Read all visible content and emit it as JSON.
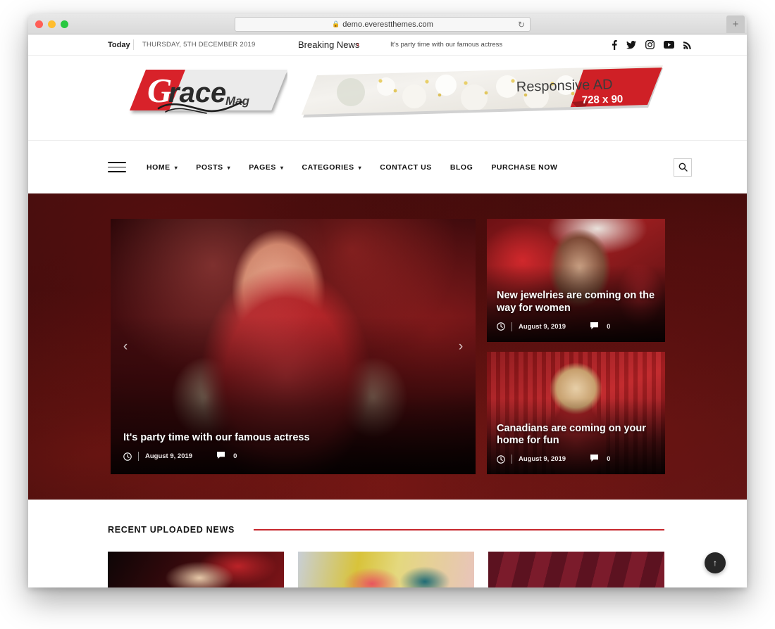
{
  "browser": {
    "url": "demo.everestthemes.com",
    "lock_icon": "lock-icon",
    "reload_icon": "reload-icon",
    "new_tab_icon": "plus-icon"
  },
  "topbar": {
    "today_label": "Today",
    "date": "THURSDAY, 5TH DECEMBER 2019",
    "breaking_label": "Breaking News",
    "breaking_arrow": "›",
    "breaking_text": "It's party time with our famous actress",
    "social": [
      {
        "name": "facebook-icon",
        "label": "Facebook"
      },
      {
        "name": "twitter-icon",
        "label": "Twitter"
      },
      {
        "name": "instagram-icon",
        "label": "Instagram"
      },
      {
        "name": "youtube-icon",
        "label": "YouTube"
      },
      {
        "name": "rss-icon",
        "label": "RSS"
      }
    ]
  },
  "logo": {
    "initial": "G",
    "name": "race",
    "suffix": "Mag",
    "red": "#d8232a",
    "grey": "#e9e9e9"
  },
  "ad": {
    "title": "Responsive AD",
    "size": "728 x 90",
    "accent": "#cf2026"
  },
  "nav": {
    "hamburger_icon": "hamburger-icon",
    "items": [
      {
        "label": "HOME",
        "has_dropdown": true
      },
      {
        "label": "POSTS",
        "has_dropdown": true
      },
      {
        "label": "PAGES",
        "has_dropdown": true
      },
      {
        "label": "CATEGORIES",
        "has_dropdown": true
      },
      {
        "label": "CONTACT US",
        "has_dropdown": false
      },
      {
        "label": "BLOG",
        "has_dropdown": false
      },
      {
        "label": "PURCHASE NOW",
        "has_dropdown": false
      }
    ],
    "search_icon": "search-icon",
    "caret_glyph": "⌄"
  },
  "hero": {
    "prev_icon": "chevron-left-icon",
    "next_icon": "chevron-right-icon",
    "prev_glyph": "‹",
    "next_glyph": "›",
    "main": {
      "title": "It's party time with our famous actress",
      "date": "August 9, 2019",
      "comments": "0",
      "clock_icon": "clock-icon",
      "comment_icon": "comment-icon"
    },
    "side": [
      {
        "title": "New jewelries are coming on the way for women",
        "date": "August 9, 2019",
        "comments": "0",
        "clock_icon": "clock-icon",
        "comment_icon": "comment-icon"
      },
      {
        "title": "Canadians are coming on your home for fun",
        "date": "August 9, 2019",
        "comments": "0",
        "clock_icon": "clock-icon",
        "comment_icon": "comment-icon"
      }
    ]
  },
  "recent": {
    "heading": "RECENT UPLOADED NEWS",
    "rule_color": "#c7272d",
    "thumbs": [
      {
        "name": "recent-thumb-1"
      },
      {
        "name": "recent-thumb-2"
      },
      {
        "name": "recent-thumb-3"
      }
    ]
  },
  "scroll_top": {
    "icon": "arrow-up-icon",
    "glyph": "↑"
  }
}
